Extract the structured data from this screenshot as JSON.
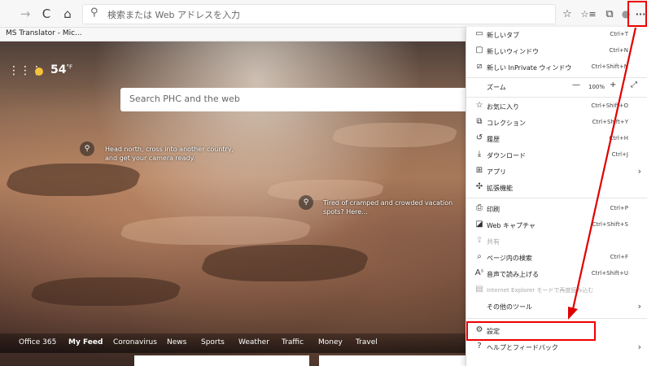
{
  "toolbar": {
    "back_icon": "→",
    "refresh_icon": "C",
    "home_icon": "⌂",
    "search_icon": "⚲",
    "address_placeholder": "検索または Web アドレスを入力",
    "read_aloud_icon": "☆",
    "favorites_icon": "☆≡",
    "collections_icon": "⧉",
    "profile_icon": "●",
    "more_icon": "···"
  },
  "favorites_bar": {
    "item": "MS Translator - Mic..."
  },
  "newtab": {
    "apps_icon": "⋮⋮⋮",
    "temperature": "54",
    "unit": "°F",
    "search_placeholder": "Search PHC and the web",
    "hotspot_icon": "⚲",
    "hotspot1": "Head north, cross into another country, and get your camera ready.",
    "hotspot2": "Tired of cramped and crowded vacation spots? Here..."
  },
  "feed_tabs": [
    "Office 365",
    "My Feed",
    "Coronavirus",
    "News",
    "Sports",
    "Weather",
    "Traffic",
    "Money",
    "Travel"
  ],
  "menu": {
    "new_tab": "新しいタブ",
    "new_tab_sc": "Ctrl+T",
    "new_window": "新しいウィンドウ",
    "new_window_sc": "Ctrl+N",
    "new_inprivate": "新しい InPrivate ウィンドウ",
    "new_inprivate_sc": "Ctrl+Shift+N",
    "zoom": "ズーム",
    "zoom_minus": "—",
    "zoom_value": "100%",
    "zoom_plus": "+",
    "fullscreen_icon": "⤢",
    "favorites": "お気に入り",
    "favorites_sc": "Ctrl+Shift+O",
    "collections": "コレクション",
    "collections_sc": "Ctrl+Shift+Y",
    "history": "履歴",
    "history_sc": "Ctrl+H",
    "downloads": "ダウンロード",
    "downloads_sc": "Ctrl+J",
    "apps": "アプリ",
    "extensions": "拡張機能",
    "print": "印刷",
    "print_sc": "Ctrl+P",
    "web_capture": "Web キャプチャ",
    "web_capture_sc": "Ctrl+Shift+S",
    "share": "共有",
    "find": "ページ内の検索",
    "find_sc": "Ctrl+F",
    "read_aloud": "音声で読み上げる",
    "read_aloud_sc": "Ctrl+Shift+U",
    "ie_mode": "Internet Explorer モードで再度読み込む",
    "more_tools": "その他のツール",
    "settings": "設定",
    "help": "ヘルプとフィードバック",
    "chevron": "›"
  },
  "colors": {
    "annotation": "#e00000",
    "sun": "#f6c23c"
  }
}
